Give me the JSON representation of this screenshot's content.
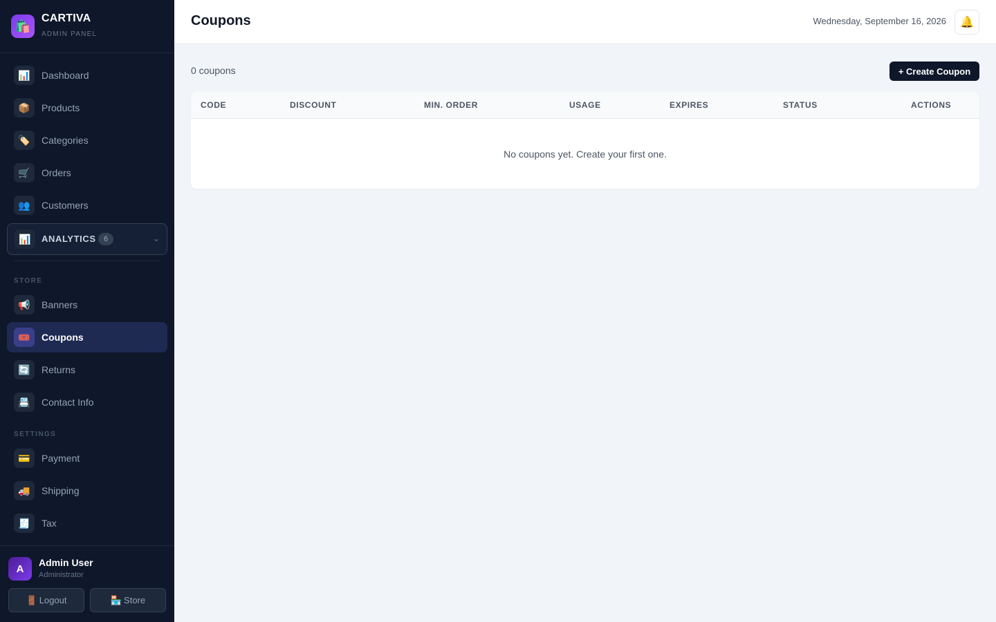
{
  "brand": {
    "name": "CARTIVA",
    "subtitle": "ADMIN PANEL",
    "logo_icon": "shopping-bags-icon"
  },
  "sidebar": {
    "main_items": [
      {
        "label": "Dashboard",
        "icon": "📊"
      },
      {
        "label": "Products",
        "icon": "📦"
      },
      {
        "label": "Categories",
        "icon": "🏷️"
      },
      {
        "label": "Orders",
        "icon": "🛒"
      },
      {
        "label": "Customers",
        "icon": "👥"
      }
    ],
    "analytics": {
      "label": "ANALYTICS",
      "count": "6",
      "icon": "📊"
    },
    "store_label": "STORE",
    "store_items": [
      {
        "label": "Banners",
        "icon": "📢"
      },
      {
        "label": "Coupons",
        "icon": "🎟️",
        "active": true
      },
      {
        "label": "Returns",
        "icon": "🔄"
      },
      {
        "label": "Contact Info",
        "icon": "📇"
      }
    ],
    "settings_label": "SETTINGS",
    "settings_items": [
      {
        "label": "Payment",
        "icon": "💳"
      },
      {
        "label": "Shipping",
        "icon": "🚚"
      },
      {
        "label": "Tax",
        "icon": "🧾"
      }
    ],
    "user": {
      "initial": "A",
      "name": "Admin User",
      "role": "Administrator"
    },
    "logout_label": "Logout",
    "logout_icon": "🚪",
    "store_label_btn": "Store",
    "store_icon": "🏪"
  },
  "header": {
    "title": "Coupons",
    "date": "Wednesday, September 16, 2026",
    "bell_icon": "🔔"
  },
  "main": {
    "count_text": "0 coupons",
    "create_label": "+ Create Coupon",
    "columns": [
      "CODE",
      "DISCOUNT",
      "MIN. ORDER",
      "USAGE",
      "EXPIRES",
      "STATUS",
      "ACTIONS"
    ],
    "empty_text": "No coupons yet. Create your first one."
  },
  "colors": {
    "sidebar_bg": "#0f172a",
    "active_bg": "#1e2a52",
    "primary_button": "#0f172a",
    "page_bg": "#f1f4f9"
  }
}
